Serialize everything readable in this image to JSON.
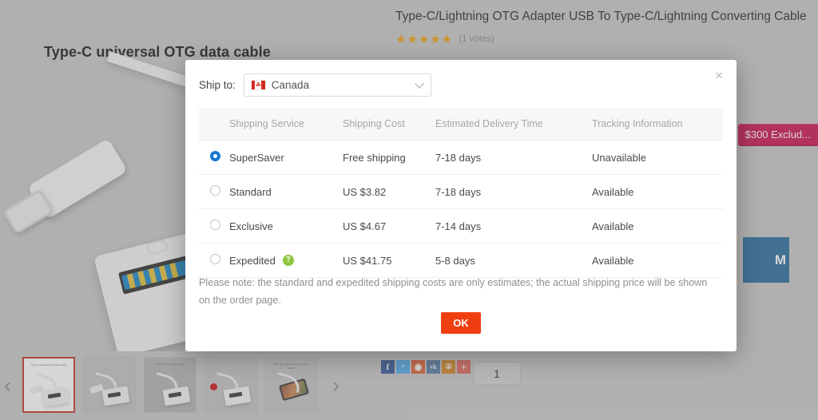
{
  "background": {
    "photo_caption": "Type-C universal OTG data cable",
    "product_title": "Type-C/Lightning OTG Adapter USB To Type-C/Lightning Converting Cable",
    "stars": "★★★★★",
    "votes": "(1 votes)",
    "badge": "$300 Exclud...",
    "blue_button": "M",
    "quantity": "1",
    "nav_prev": "‹",
    "nav_next": "›",
    "social": [
      {
        "name": "facebook",
        "glyph": "f"
      },
      {
        "name": "twitter",
        "glyph": "ᵒ"
      },
      {
        "name": "reddit",
        "glyph": "◉"
      },
      {
        "name": "vk",
        "glyph": "vk"
      },
      {
        "name": "odnoklassniki",
        "glyph": "②"
      },
      {
        "name": "share-more",
        "glyph": "+"
      }
    ],
    "thumbnails": [
      {
        "label": "Type-C universal OTG data cable",
        "active": true
      },
      {
        "label": "",
        "active": false
      },
      {
        "label": "Type-C OTG adapter cable",
        "active": false
      },
      {
        "label": "",
        "active": false
      },
      {
        "label": "OTG data cable connect to phone directly",
        "active": false
      }
    ]
  },
  "modal": {
    "close_label": "×",
    "ship_to_label": "Ship to:",
    "country": "Canada",
    "flag_leaf": "☘",
    "table": {
      "headers": [
        "",
        "Shipping Service",
        "Shipping Cost",
        "Estimated Delivery Time",
        "Tracking Information"
      ],
      "rows": [
        {
          "selected": true,
          "service": "SuperSaver",
          "has_help": false,
          "cost": "Free shipping",
          "time": "7-18 days",
          "tracking": "Unavailable"
        },
        {
          "selected": false,
          "service": "Standard",
          "has_help": false,
          "cost": "US $3.82",
          "time": "7-18 days",
          "tracking": "Available"
        },
        {
          "selected": false,
          "service": "Exclusive",
          "has_help": false,
          "cost": "US $4.67",
          "time": "7-14 days",
          "tracking": "Available"
        },
        {
          "selected": false,
          "service": "Expedited",
          "has_help": true,
          "cost": "US $41.75",
          "time": "5-8 days",
          "tracking": "Available"
        }
      ]
    },
    "help_glyph": "?",
    "note": "Please note: the standard and expedited shipping costs are only estimates; the actual shipping price will be shown on the order page.",
    "ok_label": "OK"
  },
  "colors": {
    "accent_orange": "#ef3f10",
    "cost_red": "#d94413",
    "radio_blue": "#1878d4",
    "badge_crimson": "#cc1452",
    "button_blue": "#2a6e9e",
    "help_green": "#8ec640",
    "star_orange": "#f2a008"
  }
}
